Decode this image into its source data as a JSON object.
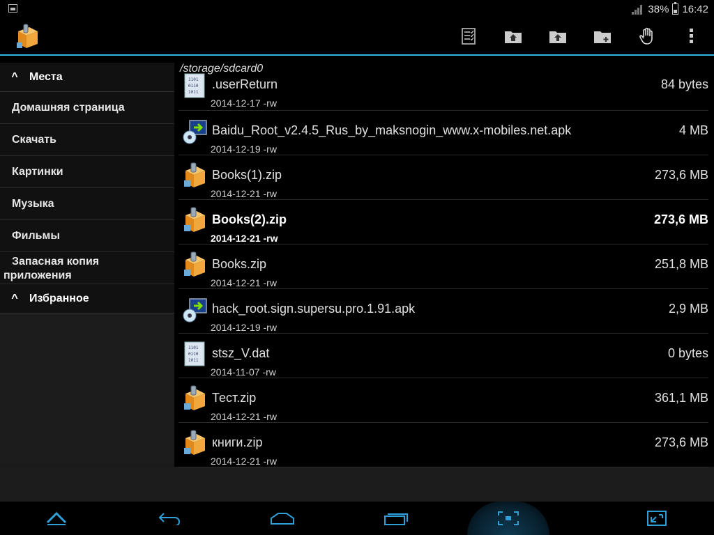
{
  "status_bar": {
    "battery_percent": "38%",
    "time": "16:42",
    "icons": [
      "image-notification-icon",
      "signal-icon",
      "battery-icon"
    ]
  },
  "action_bar": {
    "app_icon": "file-manager-box-icon",
    "actions": [
      "select-multiple-icon",
      "home-folder-icon",
      "upload-folder-icon",
      "new-folder-icon",
      "hand-icon",
      "overflow-menu-icon"
    ]
  },
  "sidebar": {
    "places_header": "Места",
    "items": [
      {
        "label": "Домашняя страница"
      },
      {
        "label": "Скачать"
      },
      {
        "label": "Картинки"
      },
      {
        "label": "Музыка"
      },
      {
        "label": "Фильмы"
      },
      {
        "label_line1": "Запасная копия",
        "label_line2": "приложения"
      }
    ],
    "favorites_header": "Избранное"
  },
  "file_browser": {
    "path": "/storage/sdcard0",
    "files": [
      {
        "name": ".userReturn",
        "meta": "2014-12-17 -rw",
        "size": "84 bytes",
        "icon": "binary-file-icon"
      },
      {
        "name": "Baidu_Root_v2.4.5_Rus_by_maksnogin_www.x-mobiles.net.apk",
        "meta": "2014-12-19 -rw",
        "size": "4 MB",
        "icon": "apk-install-icon"
      },
      {
        "name": "Books(1).zip",
        "meta": "2014-12-21 -rw",
        "size": "273,6 MB",
        "icon": "zip-archive-icon"
      },
      {
        "name": "Books(2).zip",
        "meta": "2014-12-21 -rw",
        "size": "273,6 MB",
        "icon": "zip-archive-icon"
      },
      {
        "name": "Books.zip",
        "meta": "2014-12-21 -rw",
        "size": "251,8 MB",
        "icon": "zip-archive-icon"
      },
      {
        "name": "hack_root.sign.supersu.pro.1.91.apk",
        "meta": "2014-12-19 -rw",
        "size": "2,9 MB",
        "icon": "apk-install-icon"
      },
      {
        "name": "stsz_V.dat",
        "meta": "2014-11-07 -rw",
        "size": "0 bytes",
        "icon": "binary-file-icon"
      },
      {
        "name": "Тест.zip",
        "meta": "2014-12-21 -rw",
        "size": "361,1 MB",
        "icon": "zip-archive-icon"
      },
      {
        "name": "книги.zip",
        "meta": "2014-12-21 -rw",
        "size": "273,6 MB",
        "icon": "zip-archive-icon"
      }
    ]
  },
  "nav_bar": {
    "buttons": [
      "hide-bar-icon",
      "back-icon",
      "home-icon",
      "recents-icon",
      "screenshot-icon",
      "expand-icon"
    ]
  },
  "colors": {
    "accent": "#33b5e5",
    "nav_icon": "#2f9fd8",
    "background": "#000000",
    "sidebar": "#111111"
  }
}
